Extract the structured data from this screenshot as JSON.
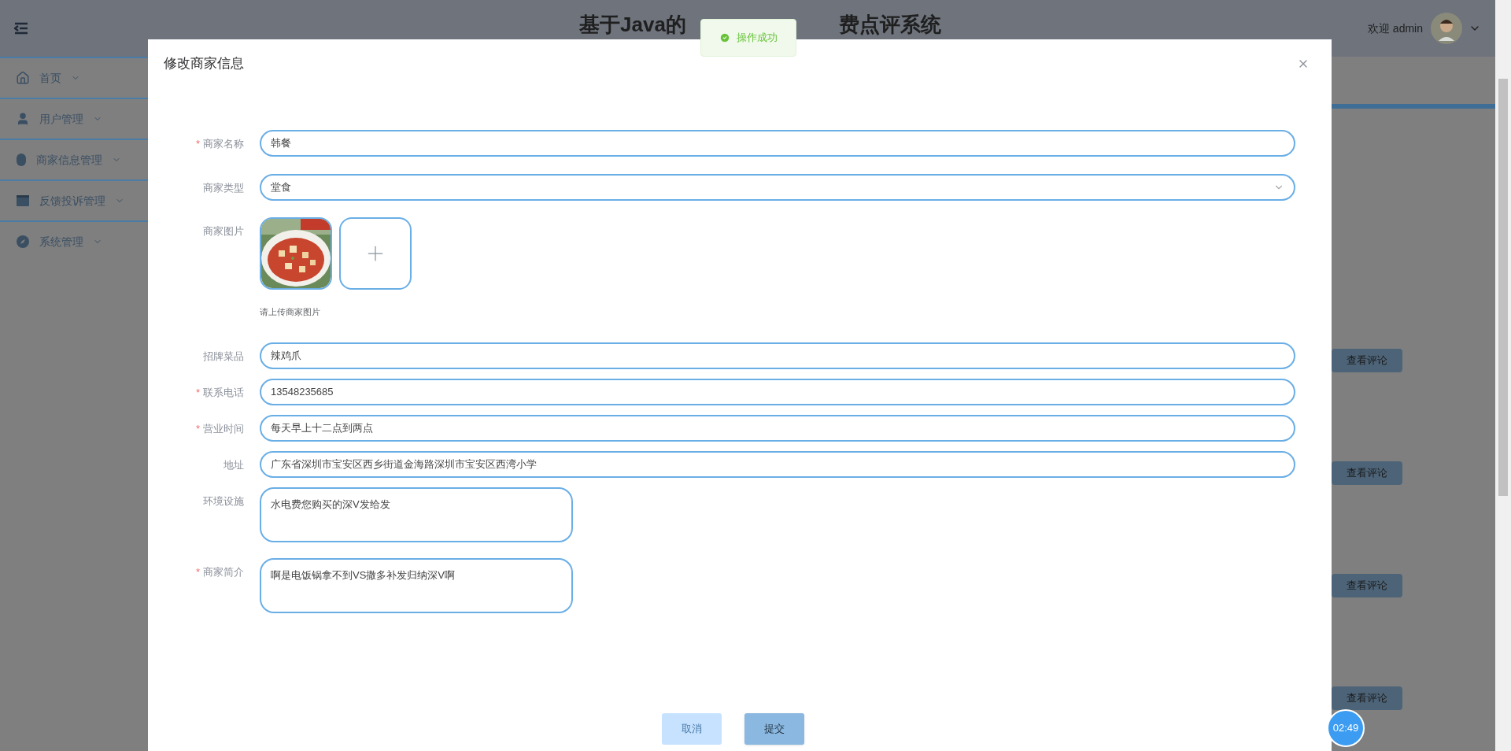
{
  "header": {
    "title_left": "基于Java的",
    "title_right": "费点评系统",
    "greeting": "欢迎 admin"
  },
  "sidebar": {
    "items": [
      {
        "label": "首页",
        "kind": "home"
      },
      {
        "label": "用户管理",
        "kind": "user"
      },
      {
        "label": "商家信息管理",
        "kind": "mouse"
      },
      {
        "label": "反馈投诉管理",
        "kind": "card"
      },
      {
        "label": "系统管理",
        "kind": "compass"
      }
    ]
  },
  "content": {
    "buttons": [
      "查看评论",
      "查看评论",
      "查看评论",
      "查看评论"
    ]
  },
  "toast": {
    "message": "操作成功"
  },
  "dialog": {
    "title": "修改商家信息",
    "required_mark": "*",
    "fields": [
      {
        "kind": "input",
        "label": "商家名称",
        "required": true,
        "value": "韩餐"
      },
      {
        "kind": "select",
        "label": "商家类型",
        "required": false,
        "value": "堂食"
      },
      {
        "label": "商家图片",
        "required": false,
        "hint": "请上传商家图片"
      },
      {
        "kind": "input",
        "label": "招牌菜品",
        "required": false,
        "value": "辣鸡爪"
      },
      {
        "kind": "input",
        "label": "联系电话",
        "required": true,
        "value": "13548235685"
      },
      {
        "kind": "input",
        "label": "营业时间",
        "required": true,
        "value": "每天早上十二点到两点"
      },
      {
        "kind": "input",
        "label": "地址",
        "required": false,
        "value": "广东省深圳市宝安区西乡街道金海路深圳市宝安区西湾小学"
      },
      {
        "kind": "textarea",
        "label": "环境设施",
        "required": false,
        "value": "水电费您购买的深V发给发"
      },
      {
        "kind": "textarea",
        "label": "商家简介",
        "required": true,
        "value": "啊是电饭锅拿不到VS撒多补发归纳深V啊"
      }
    ],
    "buttons": [
      {
        "label": "取消",
        "disabled": true
      },
      {
        "label": "提交",
        "disabled": false
      }
    ]
  },
  "timer": "02:49"
}
